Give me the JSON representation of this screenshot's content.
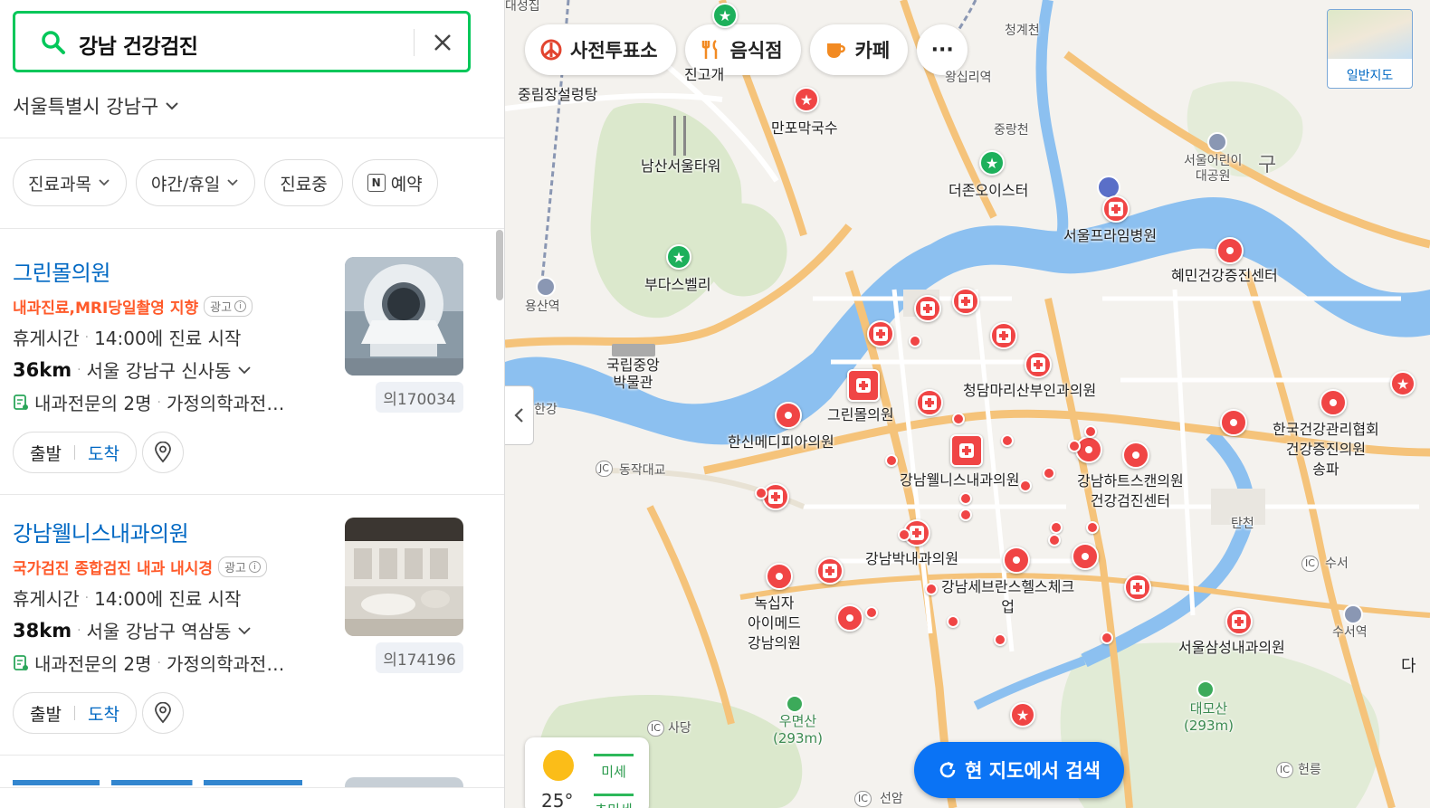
{
  "search": {
    "query": "강남 건강검진"
  },
  "region": {
    "label": "서울특별시 강남구"
  },
  "filters": [
    {
      "label": "진료과목"
    },
    {
      "label": "야간/휴일"
    },
    {
      "label": "진료중"
    },
    {
      "label": "예약",
      "badge": "N"
    }
  ],
  "results": [
    {
      "name": "그린몰의원",
      "promo": "내과진료,MRI당일촬영 지향",
      "ad": "광고",
      "status": "휴게시간",
      "status_detail": "14:00에 진료 시작",
      "distance": "36km",
      "address": "서울 강남구 신사동",
      "doctors": "내과전문의 2명",
      "doctors_more": "가정의학과전…",
      "code": "의170034",
      "depart": "출발",
      "arrive": "도착"
    },
    {
      "name": "강남웰니스내과의원",
      "promo": "국가검진 종합검진 내과 내시경",
      "ad": "광고",
      "status": "휴게시간",
      "status_detail": "14:00에 진료 시작",
      "distance": "38km",
      "address": "서울 강남구 역삼동",
      "doctors": "내과전문의 2명",
      "doctors_more": "가정의학과전…",
      "code": "의174196",
      "depart": "출발",
      "arrive": "도착"
    }
  ],
  "map": {
    "categories": [
      {
        "label": "사전투표소",
        "icon": "vote-icon"
      },
      {
        "label": "음식점",
        "icon": "restaurant-icon"
      },
      {
        "label": "카페",
        "icon": "cafe-icon"
      },
      {
        "label": "···",
        "icon": "more-icon"
      }
    ],
    "map_type": "일반지도",
    "research_button": "현 지도에서 검색",
    "weather": {
      "temp": "25°",
      "pm10": "미세",
      "pm25": "초미세"
    },
    "labels": {
      "jungrim": "중림장설렁탕",
      "jingogae": "진고개",
      "manpo": "만포막국수",
      "namsan": "남산서울타워",
      "budas": "부다스벨리",
      "yongsan": "용산역",
      "museum": "국립중앙\n박물관",
      "hangang": "한강",
      "dongjak": "동작대교",
      "cheonggye": "청계천",
      "wangsimni": "왕십리역",
      "jungnang": "중랑천",
      "oyster": "더존오이스터",
      "childpark": "서울어린이\n대공원",
      "prime": "서울프라임병원",
      "hyemin": "혜민건강증진센터",
      "greenmall": "그린몰의원",
      "cheongdam": "청담마리산부인과의원",
      "hanshin": "한신메디피아의원",
      "wellness": "강남웰니스내과의원",
      "heart": "강남하트스캔의원\n건강검진센터",
      "korea": "한국건강관리협회\n건강증진의원\n송파",
      "tancheon": "탄천",
      "park": "강남박내과의원",
      "severance": "강남세브란스헬스체크\n업",
      "greencross": "녹십자\n아이메드\n강남의원",
      "samsung": "서울삼성내과의원",
      "suseo_ic": "수서",
      "suseo": "수서역",
      "umyeon": "우면산\n(293m)",
      "daemo": "대모산\n(293m)",
      "sadang": "사당",
      "heolleung": "헌릉",
      "seoam": "선암",
      "dagu": "구",
      "da": "다",
      "daesung": "대성집",
      "jc": "JC",
      "ic": "IC"
    }
  },
  "colors": {
    "brand": "#03c75a",
    "link": "#0068c3",
    "promo": "#ff5a2a",
    "marker": "#f04545",
    "button": "#0a73f5"
  }
}
